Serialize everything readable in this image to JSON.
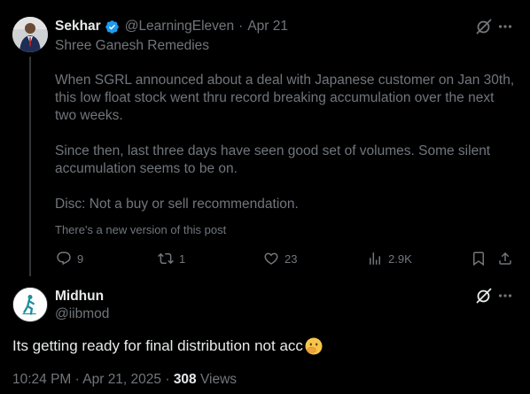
{
  "tweet1": {
    "author_name": "Sekhar",
    "handle": "@LearningEleven",
    "separator": "·",
    "date": "Apr 21",
    "subtitle": "Shree Ganesh Remedies",
    "paragraphs": [
      "When SGRL announced about a deal with Japanese customer on Jan 30th, this low float stock went thru record breaking accumulation over the next two weeks.",
      "Since then, last three days have seen good set of volumes. Some silent accumulation seems to be on.",
      "Disc: Not a buy or sell recommendation."
    ],
    "new_version_note": "There's a new version of this post",
    "stats": {
      "replies": "9",
      "reposts": "1",
      "likes": "23",
      "views": "2.9K"
    },
    "icons": {
      "verified": "verified-badge-icon",
      "grok": "grok-icon",
      "more": "more-icon",
      "reply": "reply-icon",
      "repost": "repost-icon",
      "like": "heart-icon",
      "views": "analytics-icon",
      "bookmark": "bookmark-icon",
      "share": "share-icon"
    }
  },
  "tweet2": {
    "author_name": "Midhun",
    "handle": "@iibmod",
    "text": "Its getting ready for final distribution not acc",
    "emoji": "face-with-hand-over-mouth-emoji",
    "timestamp": "10:24 PM · Apr 21, 2025 · ",
    "views_count": "308",
    "views_label": " Views"
  },
  "colors": {
    "background": "#000000",
    "primary_text": "#e7e9ea",
    "secondary_text": "#71767b",
    "verified_blue": "#1d9bf0",
    "thread_line": "#333639"
  }
}
